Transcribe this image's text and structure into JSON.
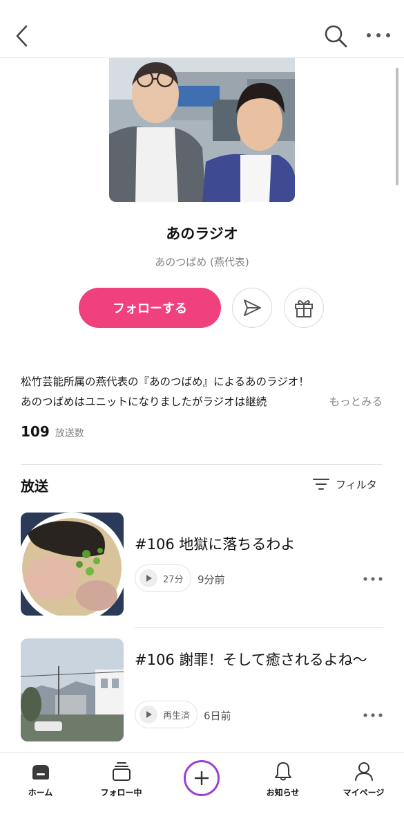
{
  "header": {
    "back_icon": "chevron-left-icon",
    "search_icon": "search-icon",
    "more_icon": "more-horizontal-icon"
  },
  "show": {
    "title": "あのラジオ",
    "author": "あのつばめ (燕代表)",
    "follow_label": "フォローする",
    "share_icon": "send-icon",
    "gift_icon": "gift-icon",
    "description_line1": "松竹芸能所属の燕代表の『あのつばめ』によるあのラジオ！",
    "description_line2": "あのつばめはユニットになりましたがラジオは継続",
    "more_label": "もっとみる",
    "episode_count": "109",
    "episode_count_unit": "放送数"
  },
  "episodes_section": {
    "title": "放送",
    "filter_label": "フィルタ",
    "filter_icon": "filter-icon"
  },
  "episodes": [
    {
      "title": "#106 地獄に落ちるわよ",
      "duration": "27分",
      "ago": "9分前"
    },
    {
      "title": "#106 謝罪！そして癒されるよね〜",
      "duration": "再生済",
      "ago": "6日前"
    }
  ],
  "tabbar": {
    "items": [
      {
        "label": "ホーム",
        "icon": "home-icon"
      },
      {
        "label": "フォロー中",
        "icon": "stack-icon"
      },
      {
        "label": "",
        "icon": "plus-icon"
      },
      {
        "label": "お知らせ",
        "icon": "bell-icon"
      },
      {
        "label": "マイページ",
        "icon": "user-icon"
      }
    ]
  },
  "colors": {
    "accent_pink": "#f0407e",
    "create_ring": "#9b3fd1"
  }
}
